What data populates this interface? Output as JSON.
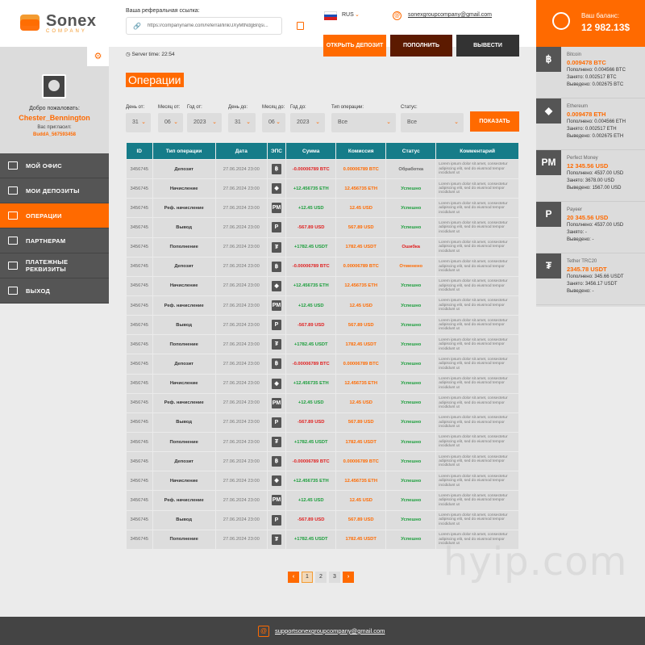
{
  "brand": {
    "name": "Sonex",
    "sub": "COMPANY"
  },
  "profile": {
    "welcome": "Добро пожаловать:",
    "username": "Chester_Bennington",
    "invited_label": "Вас пригласил:",
    "inviter": "BuddA_567593458"
  },
  "menu": [
    {
      "label": "МОЙ ОФИС",
      "icon": "office-icon",
      "active": false
    },
    {
      "label": "МОИ ДЕПОЗИТЫ",
      "icon": "deposits-icon",
      "active": false
    },
    {
      "label": "ОПЕРАЦИИ",
      "icon": "operations-icon",
      "active": true
    },
    {
      "label": "ПАРТНЕРАМ",
      "icon": "partners-icon",
      "active": false
    },
    {
      "label": "ПЛАТЕЖНЫЕ РЕКВИЗИТЫ",
      "icon": "payment-details-icon",
      "active": false
    },
    {
      "label": "ВЫХОД",
      "icon": "logout-icon",
      "active": false
    }
  ],
  "top": {
    "ref_label": "Ваша реферальная ссылка:",
    "ref_url": "https://companyname.com/referral/link/JXyMtNdgBrqsi...",
    "lang": "RUS",
    "email": "sonexgroupcompany@gmail.com",
    "btn_open": "ОТКРЫТЬ ДЕПОЗИТ",
    "btn_fund": "ПОПОЛНИТЬ",
    "btn_withdraw": "ВЫВЕСТИ"
  },
  "balance": {
    "label": "Ваш баланс:",
    "value": "12 982.13$"
  },
  "wallets": [
    {
      "icon": "bitcoin-icon",
      "glyph": "฿",
      "name": "Bitcoin",
      "amount": "0.009478 BTC",
      "rows": [
        "Пополнено: 0.004566 BTC",
        "Занято: 0.002517 BTC",
        "Выведено: 0.002675 BTC"
      ]
    },
    {
      "icon": "ethereum-icon",
      "glyph": "◆",
      "name": "Ethereum",
      "amount": "0.009478 ETH",
      "rows": [
        "Пополнено: 0.004566 ETH",
        "Занято: 0.002517 ETH",
        "Выведено: 0.002675 ETH"
      ]
    },
    {
      "icon": "perfect-money-icon",
      "glyph": "PM",
      "name": "Perfect Money",
      "amount": "12 345.56 USD",
      "rows": [
        "Пополнено: 4537.00 USD",
        "Занято: 3678.00 USD",
        "Выведено: 1567.00 USD"
      ]
    },
    {
      "icon": "payeer-icon",
      "glyph": "P",
      "name": "Payeer",
      "amount": "20 345.56 USD",
      "rows": [
        "Пополнено: 4537.00 USD",
        "Занято: -",
        "Выведено: -"
      ]
    },
    {
      "icon": "tether-icon",
      "glyph": "₮",
      "name": "Tether TRC20",
      "amount": "2345.78 USDT",
      "rows": [
        "Пополнено: 345.66 USDT",
        "Занято: 3456.17 USDT",
        "Выведено: -"
      ]
    }
  ],
  "main": {
    "server_time": "Server time: 22:54",
    "title": "Операции",
    "filters": [
      {
        "label": "День от:",
        "value": "31"
      },
      {
        "label": "Месяц от:",
        "value": "06"
      },
      {
        "label": "Год от:",
        "value": "2023"
      },
      {
        "label": "День до:",
        "value": "31"
      },
      {
        "label": "Месяц до:",
        "value": "06"
      },
      {
        "label": "Год до:",
        "value": "2023"
      },
      {
        "label": "Тип операции:",
        "value": "Все"
      },
      {
        "label": "Статус:",
        "value": "Все"
      }
    ],
    "show_btn": "ПОКАЗАТЬ"
  },
  "table": {
    "headers": [
      "ID",
      "Тип операции",
      "Дата",
      "ЭПС",
      "Сумма",
      "Комиссия",
      "Статус",
      "Комментарий"
    ],
    "comment": "Lorem ipsum dolor sit amet, consectetur adipiscing elit, sed do eiusmod tempor incididunt ut",
    "rows": [
      {
        "id": "3456745",
        "type": "Депозит",
        "date": "27.06.2024  23:00",
        "eps": "฿",
        "sum": "-0.00006789 BTC",
        "sum_color": "#e02020",
        "comm": "0.00006789 BTC",
        "status": "Обработка",
        "status_color": "#666666"
      },
      {
        "id": "3456745",
        "type": "Начисление",
        "date": "27.06.2024  23:00",
        "eps": "◆",
        "sum": "+12.456735 ETH",
        "sum_color": "#1c9e3c",
        "comm": "12.456735 ETH",
        "status": "Успешно",
        "status_color": "#1c9e3c"
      },
      {
        "id": "3456745",
        "type": "Реф. начисление",
        "date": "27.06.2024  23:00",
        "eps": "PM",
        "sum": "+12.45 USD",
        "sum_color": "#1c9e3c",
        "comm": "12.45 USD",
        "status": "Успешно",
        "status_color": "#1c9e3c"
      },
      {
        "id": "3456745",
        "type": "Вывод",
        "date": "27.06.2024  23:00",
        "eps": "P",
        "sum": "-567.89 USD",
        "sum_color": "#e02020",
        "comm": "567.89 USD",
        "status": "Успешно",
        "status_color": "#1c9e3c"
      },
      {
        "id": "3456745",
        "type": "Пополнение",
        "date": "27.06.2024  23:00",
        "eps": "₮",
        "sum": "+1782.45 USDT",
        "sum_color": "#1c9e3c",
        "comm": "1782.45 USDT",
        "status": "Ошибка",
        "status_color": "#e02020"
      },
      {
        "id": "3456745",
        "type": "Депозит",
        "date": "27.06.2024  23:00",
        "eps": "฿",
        "sum": "-0.00006789 BTC",
        "sum_color": "#e02020",
        "comm": "0.00006789 BTC",
        "status": "Отменено",
        "status_color": "#ff6a00"
      },
      {
        "id": "3456745",
        "type": "Начисление",
        "date": "27.06.2024  23:00",
        "eps": "◆",
        "sum": "+12.456735 ETH",
        "sum_color": "#1c9e3c",
        "comm": "12.456735 ETH",
        "status": "Успешно",
        "status_color": "#1c9e3c"
      },
      {
        "id": "3456745",
        "type": "Реф. начисление",
        "date": "27.06.2024  23:00",
        "eps": "PM",
        "sum": "+12.45 USD",
        "sum_color": "#1c9e3c",
        "comm": "12.45 USD",
        "status": "Успешно",
        "status_color": "#1c9e3c"
      },
      {
        "id": "3456745",
        "type": "Вывод",
        "date": "27.06.2024  23:00",
        "eps": "P",
        "sum": "-567.89 USD",
        "sum_color": "#e02020",
        "comm": "567.89 USD",
        "status": "Успешно",
        "status_color": "#1c9e3c"
      },
      {
        "id": "3456745",
        "type": "Пополнение",
        "date": "27.06.2024  23:00",
        "eps": "₮",
        "sum": "+1782.45 USDT",
        "sum_color": "#1c9e3c",
        "comm": "1782.45 USDT",
        "status": "Успешно",
        "status_color": "#1c9e3c"
      },
      {
        "id": "3456745",
        "type": "Депозит",
        "date": "27.06.2024  23:00",
        "eps": "฿",
        "sum": "-0.00006789 BTC",
        "sum_color": "#e02020",
        "comm": "0.00006789 BTC",
        "status": "Успешно",
        "status_color": "#1c9e3c"
      },
      {
        "id": "3456745",
        "type": "Начисление",
        "date": "27.06.2024  23:00",
        "eps": "◆",
        "sum": "+12.456735 ETH",
        "sum_color": "#1c9e3c",
        "comm": "12.456735 ETH",
        "status": "Успешно",
        "status_color": "#1c9e3c"
      },
      {
        "id": "3456745",
        "type": "Реф. начисление",
        "date": "27.06.2024  23:00",
        "eps": "PM",
        "sum": "+12.45 USD",
        "sum_color": "#1c9e3c",
        "comm": "12.45 USD",
        "status": "Успешно",
        "status_color": "#1c9e3c"
      },
      {
        "id": "3456745",
        "type": "Вывод",
        "date": "27.06.2024  23:00",
        "eps": "P",
        "sum": "-567.89 USD",
        "sum_color": "#e02020",
        "comm": "567.89 USD",
        "status": "Успешно",
        "status_color": "#1c9e3c"
      },
      {
        "id": "3456745",
        "type": "Пополнение",
        "date": "27.06.2024  23:00",
        "eps": "₮",
        "sum": "+1782.45 USDT",
        "sum_color": "#1c9e3c",
        "comm": "1782.45 USDT",
        "status": "Успешно",
        "status_color": "#1c9e3c"
      },
      {
        "id": "3456745",
        "type": "Депозит",
        "date": "27.06.2024  23:00",
        "eps": "฿",
        "sum": "-0.00006789 BTC",
        "sum_color": "#e02020",
        "comm": "0.00006789 BTC",
        "status": "Успешно",
        "status_color": "#1c9e3c"
      },
      {
        "id": "3456745",
        "type": "Начисление",
        "date": "27.06.2024  23:00",
        "eps": "◆",
        "sum": "+12.456735 ETH",
        "sum_color": "#1c9e3c",
        "comm": "12.456735 ETH",
        "status": "Успешно",
        "status_color": "#1c9e3c"
      },
      {
        "id": "3456745",
        "type": "Реф. начисление",
        "date": "27.06.2024  23:00",
        "eps": "PM",
        "sum": "+12.45 USD",
        "sum_color": "#1c9e3c",
        "comm": "12.45 USD",
        "status": "Успешно",
        "status_color": "#1c9e3c"
      },
      {
        "id": "3456745",
        "type": "Вывод",
        "date": "27.06.2024  23:00",
        "eps": "P",
        "sum": "-567.89 USD",
        "sum_color": "#e02020",
        "comm": "567.89 USD",
        "status": "Успешно",
        "status_color": "#1c9e3c"
      },
      {
        "id": "3456745",
        "type": "Пополнение",
        "date": "27.06.2024  23:00",
        "eps": "₮",
        "sum": "+1782.45 USDT",
        "sum_color": "#1c9e3c",
        "comm": "1782.45 USDT",
        "status": "Успешно",
        "status_color": "#1c9e3c"
      }
    ]
  },
  "pagination": {
    "prev": "‹",
    "pages": [
      "1",
      "2",
      "3"
    ],
    "current": "1",
    "next": "›"
  },
  "footer": {
    "email": "supportsonexgroupcompany@gmail.com"
  },
  "watermark": "hyip.com",
  "colors": {
    "accent": "#ff6a00",
    "table_header": "#167c89",
    "success": "#1c9e3c",
    "error": "#e02020"
  }
}
